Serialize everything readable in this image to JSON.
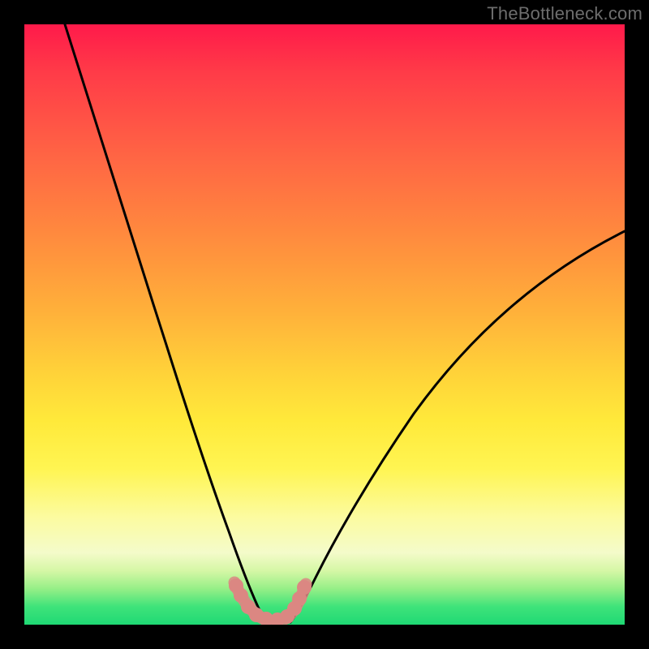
{
  "watermark": "TheBottleneck.com",
  "chart_data": {
    "type": "line",
    "title": "",
    "xlabel": "",
    "ylabel": "",
    "xlim": [
      0,
      100
    ],
    "ylim": [
      0,
      100
    ],
    "grid": false,
    "legend": false,
    "series": [
      {
        "name": "left-curve",
        "color": "#000000",
        "x": [
          7,
          12,
          16,
          20,
          24,
          27,
          29,
          31,
          33,
          34.5,
          36,
          37.5,
          38.5,
          39.2,
          40
        ],
        "y": [
          100,
          85,
          72,
          59,
          46,
          35,
          27,
          20,
          14,
          10,
          7,
          4.5,
          2.8,
          1.6,
          0.8
        ]
      },
      {
        "name": "right-curve",
        "color": "#000000",
        "x": [
          44,
          45,
          46.5,
          48.5,
          51,
          55,
          60,
          66,
          73,
          81,
          90,
          100
        ],
        "y": [
          0.8,
          1.8,
          3.5,
          6.5,
          10.5,
          17,
          25,
          33,
          41,
          49,
          57,
          65
        ]
      },
      {
        "name": "bottom-segment",
        "color": "#db8783",
        "x": [
          35,
          36.8,
          38.2,
          40,
          42,
          44,
          45.3,
          46.2
        ],
        "y": [
          5.5,
          2.8,
          1.4,
          0.6,
          0.6,
          1.4,
          3.0,
          5.2
        ]
      }
    ],
    "annotations": []
  },
  "colors": {
    "frame": "#000000",
    "curve": "#000000",
    "points": "#db8783",
    "watermark": "#6d6d6d"
  }
}
